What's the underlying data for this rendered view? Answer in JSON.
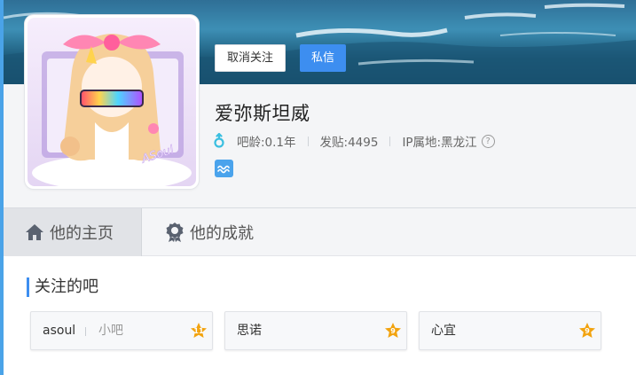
{
  "profile": {
    "username": "爱弥斯坦威",
    "unfollow_label": "取消关注",
    "message_label": "私信",
    "age": "吧龄:0.1年",
    "posts": "发贴:4495",
    "ip_location": "IP属地:黑龙江",
    "help_glyph": "?",
    "avatar_text": "ASoul",
    "icons": [
      "male-gender-icon",
      "help-icon",
      "member-badge-icon"
    ],
    "colors": {
      "accent": "#3d8ef0",
      "gender": "#3bbfe0",
      "badge": "#4aa3ec"
    }
  },
  "tabs": [
    {
      "label": "他的主页",
      "icon": "home-icon",
      "active": true
    },
    {
      "label": "他的成就",
      "icon": "achievement-icon",
      "active": false
    }
  ],
  "followed": {
    "title": "关注的吧",
    "forums": [
      {
        "name": "asoul",
        "sub": "小吧",
        "level": "11"
      },
      {
        "name": "思诺",
        "sub": "",
        "level": "9"
      },
      {
        "name": "心宜",
        "sub": "",
        "level": "9"
      }
    ],
    "level_color": "#f2a30f"
  }
}
